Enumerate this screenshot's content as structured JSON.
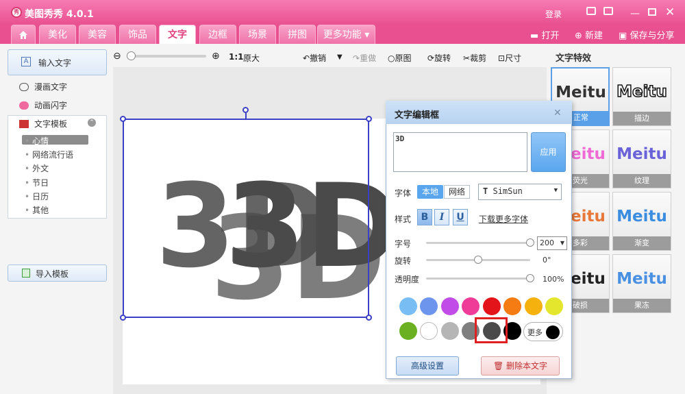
{
  "app": {
    "title": "美图秀秀 4.0.1",
    "logo_text": "秀",
    "login": "登录"
  },
  "tabs": [
    "美化",
    "美容",
    "饰品",
    "文字",
    "边框",
    "场景",
    "拼图"
  ],
  "tab_more": "更多功能",
  "header_actions": {
    "open": "打开",
    "new": "新建",
    "save_share": "保存与分享"
  },
  "left_panel": {
    "input_text": "输入文字",
    "comic_text": "漫画文字",
    "animated_text": "动画闪字",
    "templates_title": "文字模板",
    "templates": [
      "心情",
      "网络流行语",
      "外文",
      "节日",
      "日历",
      "其他"
    ],
    "import_template": "导入模板"
  },
  "toolbar": {
    "zoom_ratio": "1:1",
    "original_size": "原大",
    "undo": "撤销",
    "redo": "重做",
    "original": "原图",
    "rotate": "旋转",
    "crop": "裁剪",
    "resize": "尺寸"
  },
  "canvas": {
    "text": "3D"
  },
  "effects": {
    "title": "文字特效",
    "sample": "Meitu",
    "items": [
      {
        "name": "正常",
        "color": "#333333"
      },
      {
        "name": "描边",
        "color": "#111111"
      },
      {
        "name": "荧光",
        "color": "#f06ad6"
      },
      {
        "name": "纹理",
        "color": "#6a62d8"
      },
      {
        "name": "多彩",
        "color": "#e8783a"
      },
      {
        "name": "渐变",
        "color": "#3b8de0"
      },
      {
        "name": "破损",
        "color": "#222222"
      },
      {
        "name": "果冻",
        "color": "#4a90e2"
      }
    ]
  },
  "dialog": {
    "title": "文字编辑框",
    "text_value": "3D",
    "apply": "应用",
    "font_label": "字体",
    "font_local": "本地",
    "font_network": "网络",
    "font_name": "SimSun",
    "style_label": "样式",
    "bold": "B",
    "italic": "I",
    "underline": "U",
    "download_fonts": "下载更多字体",
    "size_label": "字号",
    "size_value": "200",
    "rotate_label": "旋转",
    "rotate_value": "0°",
    "opacity_label": "透明度",
    "opacity_value": "100%",
    "size_level": 1.0,
    "rotate_level": 0.5,
    "opacity_level": 1.0,
    "colors_row1": [
      "#78bdf4",
      "#6e95ee",
      "#c24ce8",
      "#ef3c98",
      "#e3141a",
      "#f57c12",
      "#f5b20e",
      "#e3e62c"
    ],
    "colors_row2": [
      "#6ab021",
      "#ffffff",
      "#b5b5b5",
      "#7f7f7f",
      "#4a4a4a",
      "#000000"
    ],
    "selected_color": "#4a4a4a",
    "more_colors": "更多",
    "advanced": "高级设置",
    "delete_text": "删除本文字"
  }
}
